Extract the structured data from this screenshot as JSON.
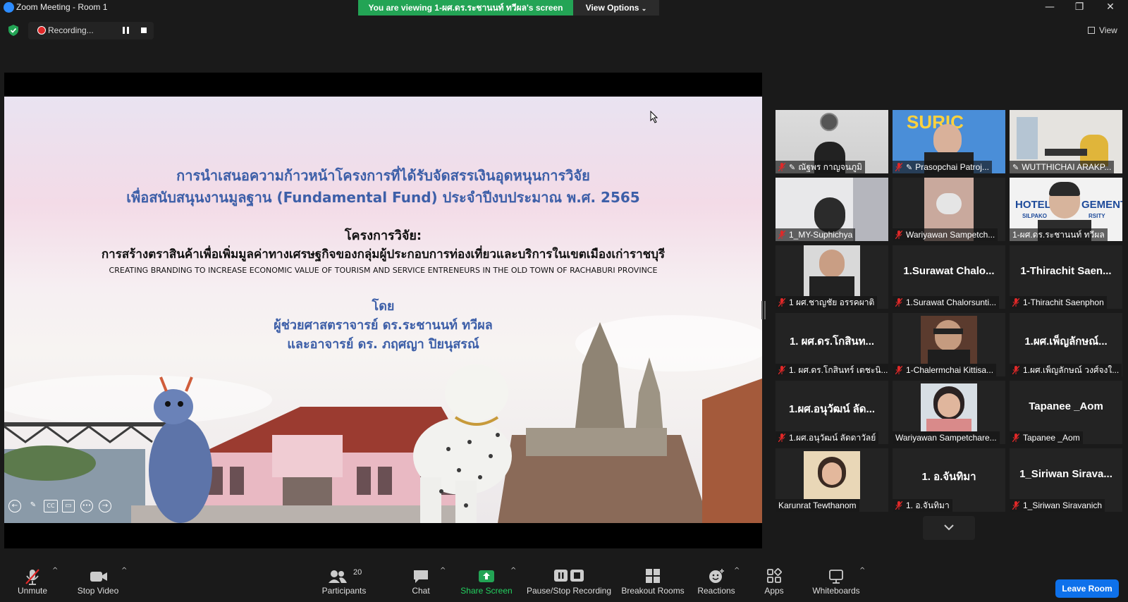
{
  "window": {
    "title": "Zoom Meeting - Room 1",
    "viewing_banner": "You are viewing 1-ผศ.ดร.ระชานนท์ ทวีผล's screen",
    "view_options_label": "View Options",
    "minimize": "—",
    "restore": "❐",
    "close": "✕"
  },
  "top": {
    "recording_label": "Recording...",
    "view_label": "View"
  },
  "slide": {
    "line1": "การนำเสนอความก้าวหน้าโครงการที่ได้รับจัดสรรเงินอุดหนุนการวิจัย",
    "line2": "เพื่อสนับสนุนงานมูลฐาน (Fundamental Fund) ประจำปีงบประมาณ พ.ศ. 2565",
    "line3": "โครงการวิจัย:",
    "line4": "การสร้างตราสินค้าเพื่อเพิ่มมูลค่าทางเศรษฐกิจของกลุ่มผู้ประกอบการท่องเที่ยวและบริการในเขตเมืองเก่าราชบุรี",
    "line5": "CREATING BRANDING TO INCREASE ECONOMIC VALUE OF TOURISM AND SERVICE  ENTRENEURS IN THE OLD TOWN OF RACHABURI PROVINCE",
    "line6": "โดย",
    "line7": "ผู้ช่วยศาสตราจารย์ ดร.ระชานนท์ ทวีผล",
    "line8": "และอาจารย์ ดร. ภฤศญา ปิยนุสรณ์",
    "annot_cc": "CC",
    "annot_more": "•••"
  },
  "participants": [
    {
      "name": "ณัฐพร กาญจนภูมิ",
      "video": true
    },
    {
      "name": "Prasopchai Patroj...",
      "video": true
    },
    {
      "name": "WUTTHICHAI ARAKP...",
      "video": true
    },
    {
      "name": "1_MY-Suphichya",
      "video": true
    },
    {
      "name": "Wariyawan Sampetch...",
      "video": true
    },
    {
      "name": "1-ผศ.ดร.ระชานนท์ ทวีผล",
      "video": true,
      "active": true
    },
    {
      "name": "1 ผศ.ชาญชัย อรรคผาติ",
      "video": true
    },
    {
      "big": "1.Surawat  Chalo...",
      "name": "1.Surawat Chalorsunti..."
    },
    {
      "big": "1-Thirachit  Saen...",
      "name": "1-Thirachit Saenphon"
    },
    {
      "big": "1. ผศ.ดร.โกสินท...",
      "name": "1. ผศ.ดร.โกสินทร์ เตชะนิ..."
    },
    {
      "name": "1-Chalermchai Kittisa...",
      "video": true
    },
    {
      "big": "1.ผศ.เพ็ญลักษณ์...",
      "name": "1.ผศ.เพ็ญลักษณ์ วงศ์จงใ..."
    },
    {
      "big": "1.ผศ.อนุวัฒน์ ลัด...",
      "name": "1.ผศ.อนุวัฒน์ ลัดดาวัลย์"
    },
    {
      "name": "Wariyawan Sampetchare...",
      "video": true
    },
    {
      "big": "Tapanee _Aom",
      "name": "Tapanee _Aom"
    },
    {
      "name": "Karunrat Tewthanom",
      "video": true
    },
    {
      "big": "1. อ.จันทิมา",
      "name": "1. อ.จันทิมา"
    },
    {
      "big": "1_Siriwan  Sirava...",
      "name": "1_Siriwan Siravanich"
    }
  ],
  "tile_text": {
    "suric": "SURIC",
    "hotel": "HOTEL",
    "gement": "GEMENT",
    "silpakorn": "SILPAKO",
    "university": "RSITY"
  },
  "toolbar": {
    "unmute": "Unmute",
    "stop_video": "Stop Video",
    "participants": "Participants",
    "participants_count": "20",
    "chat": "Chat",
    "share_screen": "Share Screen",
    "pause_recording": "Pause/Stop Recording",
    "breakout": "Breakout Rooms",
    "reactions": "Reactions",
    "apps": "Apps",
    "whiteboards": "Whiteboards",
    "leave": "Leave Room"
  },
  "colors": {
    "share_green": "#23a455",
    "leave_blue": "#0e71eb",
    "active_speaker": "#f5ef6c",
    "slide_title_blue": "#3d5fa8",
    "muted_red": "#e02828"
  }
}
